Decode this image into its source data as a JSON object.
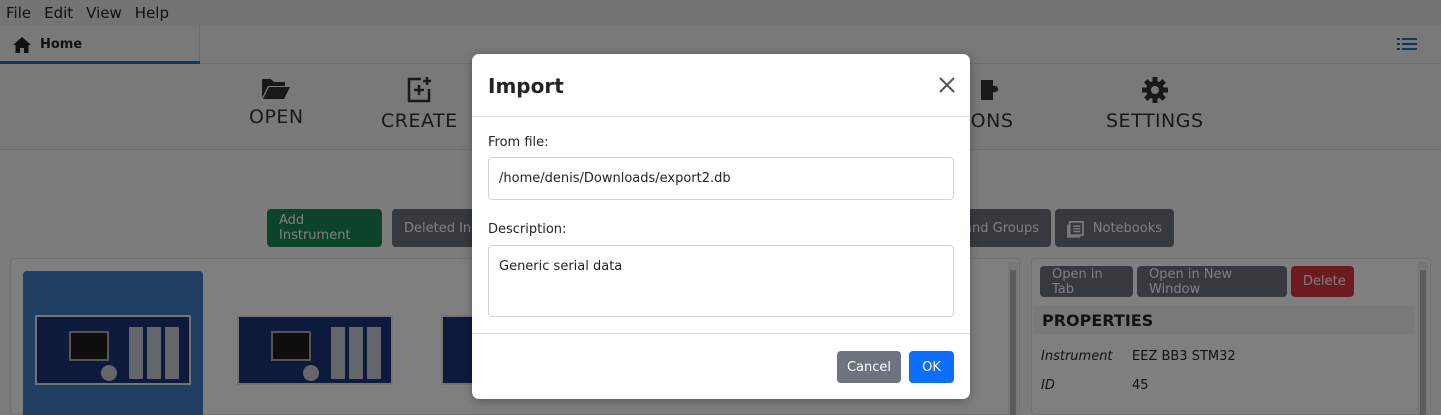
{
  "menu": [
    "File",
    "Edit",
    "View",
    "Help"
  ],
  "tabs": {
    "home_label": "Home"
  },
  "toolbar": {
    "open": "OPEN",
    "create": "CREATE",
    "extensions": "SIONS",
    "settings": "SETTINGS"
  },
  "filters": {
    "add_instrument": "Add Instrument",
    "deleted": "Deleted Inst",
    "groups": "and Groups",
    "notebooks": "Notebooks"
  },
  "details": {
    "open_in_tab": "Open in Tab",
    "open_in_new_window": "Open in New Window",
    "delete": "Delete",
    "properties_title": "PROPERTIES",
    "rows": [
      {
        "key": "Instrument",
        "value": "EEZ BB3 STM32"
      },
      {
        "key": "ID",
        "value": "45"
      }
    ]
  },
  "dialog": {
    "title": "Import",
    "from_file_label": "From file:",
    "from_file_value": "/home/denis/Downloads/export2.db",
    "description_label": "Description:",
    "description_value": "Generic serial data",
    "cancel": "Cancel",
    "ok": "OK"
  },
  "colors": {
    "primary": "#0d6efd",
    "success": "#198754",
    "secondary": "#6c757d",
    "danger": "#dc3545",
    "selected_card": "#3f7cc0"
  }
}
